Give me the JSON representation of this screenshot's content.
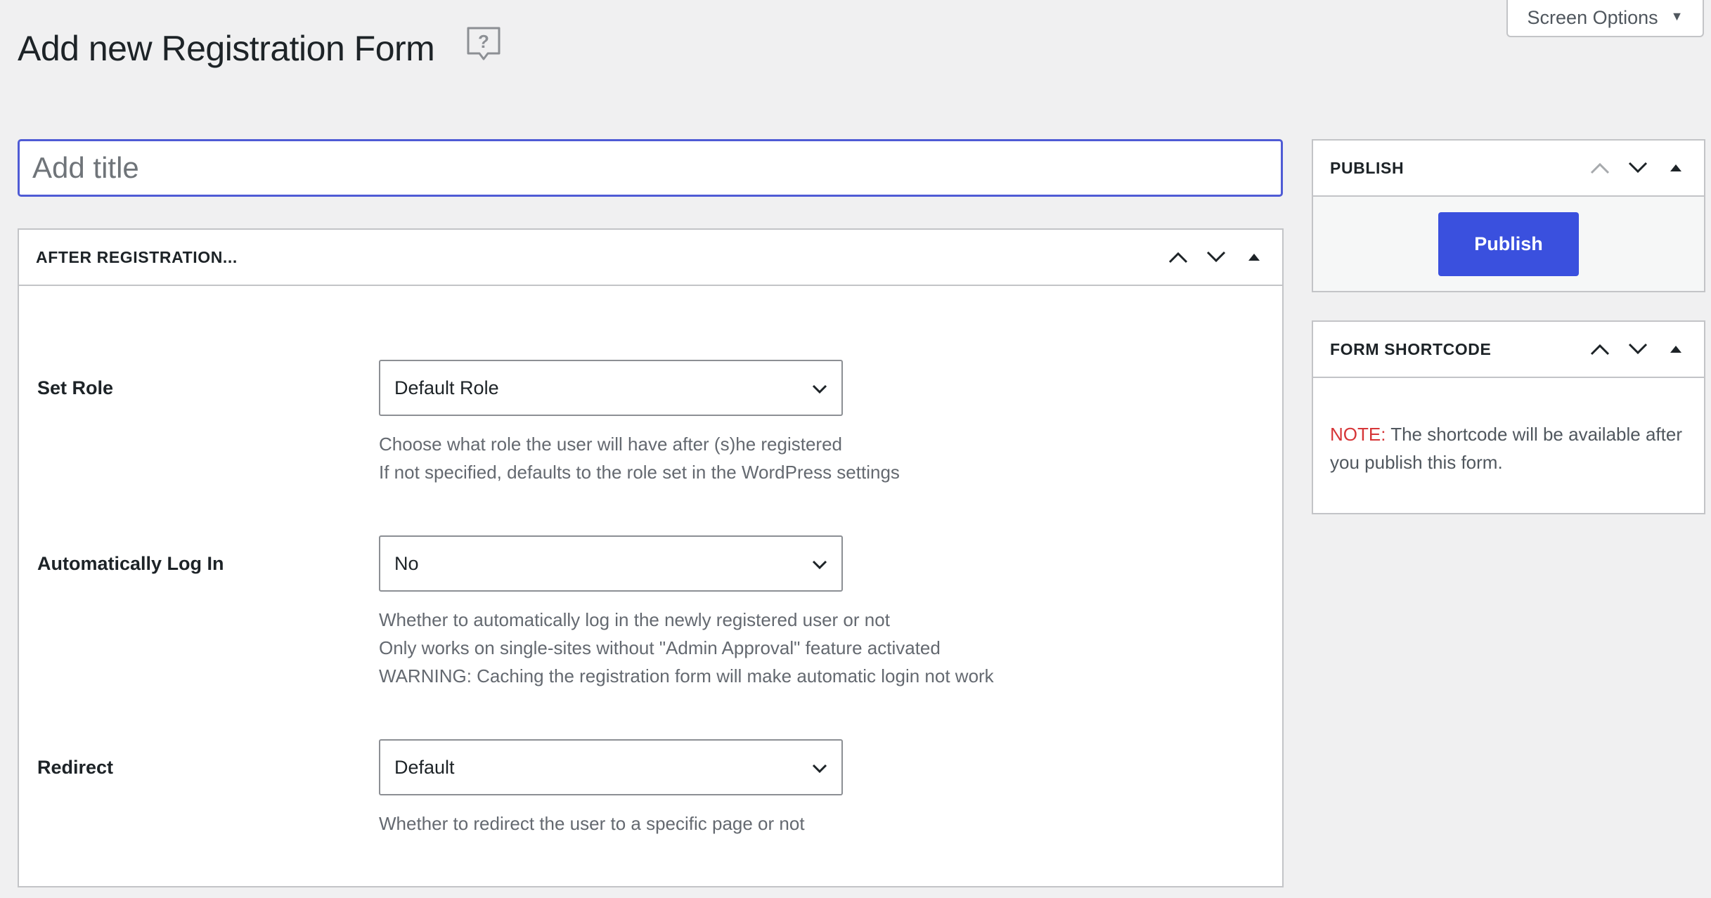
{
  "screen_options": {
    "label": "Screen Options",
    "caret": "▼"
  },
  "page": {
    "title": "Add new Registration Form",
    "help_icon": "help-question-icon"
  },
  "title_field": {
    "placeholder": "Add title",
    "value": ""
  },
  "after_registration": {
    "title": "AFTER REGISTRATION...",
    "rows": [
      {
        "label": "Set Role",
        "selected": "Default Role",
        "description": [
          "Choose what role the user will have after (s)he registered",
          "If not specified, defaults to the role set in the WordPress settings"
        ]
      },
      {
        "label": "Automatically Log In",
        "selected": "No",
        "description": [
          "Whether to automatically log in the newly registered user or not",
          "Only works on single-sites without \"Admin Approval\" feature activated",
          "WARNING: Caching the registration form will make automatic login not work"
        ]
      },
      {
        "label": "Redirect",
        "selected": "Default",
        "description": [
          "Whether to redirect the user to a specific page or not"
        ]
      }
    ]
  },
  "publish_box": {
    "title": "PUBLISH",
    "button_label": "Publish"
  },
  "shortcode_box": {
    "title": "FORM SHORTCODE",
    "note_label": "NOTE:",
    "note_text": " The shortcode will be available after you publish this form."
  },
  "colors": {
    "background": "#f0f0f1",
    "accent": "#3a50de",
    "focus_border": "#4f5bd5",
    "note_red": "#d63638",
    "muted_text": "#646970"
  }
}
